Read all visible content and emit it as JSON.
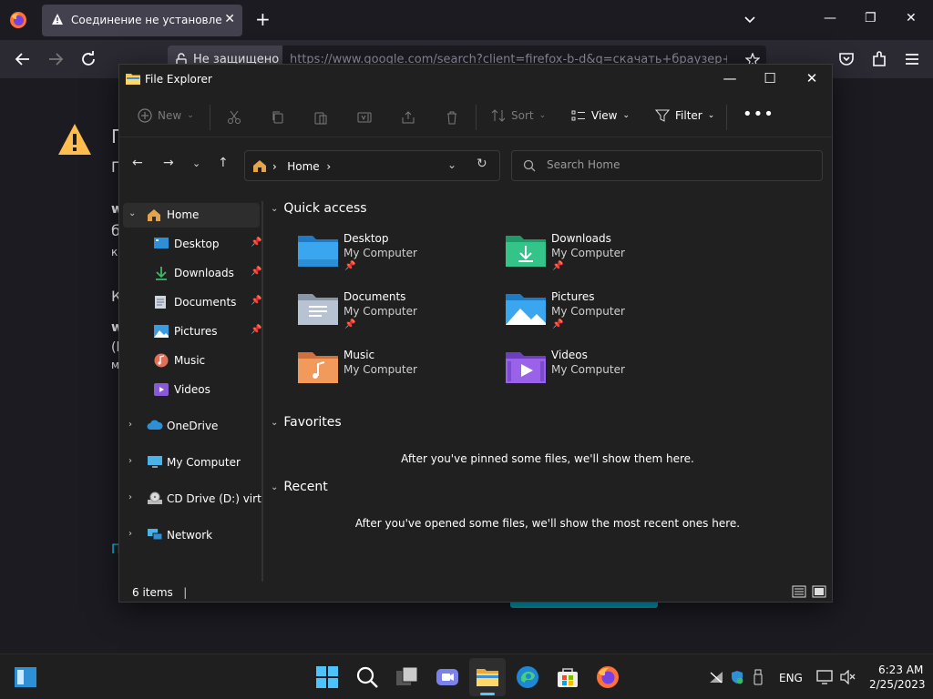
{
  "browser": {
    "tab_title": "Соединение не установлено: Потенциальная проблема безопасности",
    "identity_label": "Не защищено",
    "url": "https://www.google.com/search?client=firefox-b-d&q=скачать+браузер+ceht"
  },
  "background_page": {
    "fragments": [
      "П",
      "П",
      "w",
      "б",
      "к",
      "К",
      "w",
      "(l",
      "м",
      "П"
    ]
  },
  "explorer": {
    "title": "File Explorer",
    "toolbar": {
      "new_label": "New",
      "sort_label": "Sort",
      "view_label": "View",
      "filter_label": "Filter"
    },
    "address": {
      "current": "Home",
      "search_placeholder": "Search Home"
    },
    "nav": {
      "home": "Home",
      "pinned": [
        "Desktop",
        "Downloads",
        "Documents",
        "Pictures",
        "Music",
        "Videos"
      ],
      "onedrive": "OneDrive",
      "my_computer": "My Computer",
      "cd_drive": "CD Drive (D:) virtio-win",
      "network": "Network"
    },
    "quick_access": {
      "heading": "Quick access",
      "items": [
        {
          "name": "Desktop",
          "location": "My Computer"
        },
        {
          "name": "Downloads",
          "location": "My Computer"
        },
        {
          "name": "Documents",
          "location": "My Computer"
        },
        {
          "name": "Pictures",
          "location": "My Computer"
        },
        {
          "name": "Music",
          "location": "My Computer"
        },
        {
          "name": "Videos",
          "location": "My Computer"
        }
      ]
    },
    "favorites": {
      "heading": "Favorites",
      "empty": "After you've pinned some files, we'll show them here."
    },
    "recent": {
      "heading": "Recent",
      "empty": "After you've opened some files, we'll show the most recent ones here."
    },
    "status": {
      "count": "6 items"
    }
  },
  "taskbar": {
    "language": "ENG",
    "time": "6:23 AM",
    "date": "2/25/2023"
  },
  "colors": {
    "accent": "#0078d4",
    "folder_yellow": "#f4c34a",
    "ff_cyan": "#00ddff"
  }
}
